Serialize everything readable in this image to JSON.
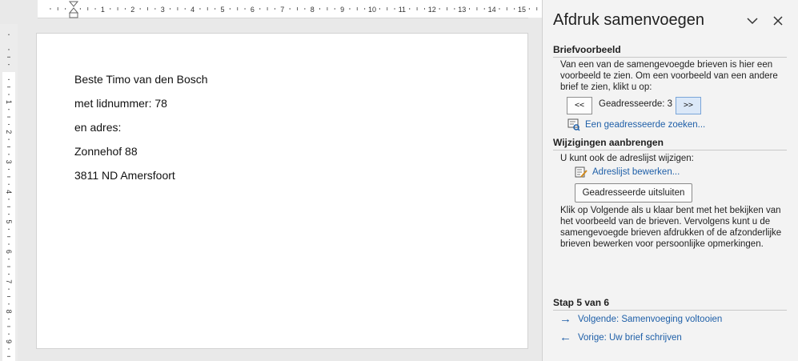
{
  "ruler": {
    "numbers": [
      "1",
      "2",
      "3",
      "4",
      "5",
      "6",
      "7",
      "8",
      "9",
      "10",
      "11",
      "12",
      "13",
      "14",
      "15"
    ],
    "vnumbers": [
      "1",
      "2",
      "3",
      "4",
      "5",
      "6",
      "7",
      "8",
      "9"
    ]
  },
  "document": {
    "lines": [
      "Beste Timo van den Bosch",
      "met lidnummer: 78",
      "en adres:",
      "Zonnehof 88",
      "3811 ND Amersfoort"
    ]
  },
  "pane": {
    "title": "Afdruk samenvoegen",
    "collapse_icon": "chevron-down-icon",
    "close_icon": "close-icon",
    "preview": {
      "heading": "Briefvoorbeeld",
      "description": "Van een van de samengevoegde brieven is hier een voorbeeld te zien. Om een voorbeeld van een andere brief te zien, klikt u op:",
      "prev_label": "<<",
      "recipient_label": "Geadresseerde: 3",
      "next_label": ">>",
      "find_link": "Een geadresseerde zoeken..."
    },
    "changes": {
      "heading": "Wijzigingen aanbrengen",
      "description": "U kunt ook de adreslijst wijzigen:",
      "edit_link": "Adreslijst bewerken...",
      "exclude_button": "Geadresseerde uitsluiten",
      "info": "Klik op Volgende als u klaar bent met het bekijken van het voorbeeld van de brieven. Vervolgens kunt u de samengevoegde brieven afdrukken of de afzonderlijke brieven bewerken voor persoonlijke opmerkingen."
    },
    "step": {
      "heading": "Stap 5 van 6",
      "next_link": "Volgende: Samenvoeging voltooien",
      "prev_link": "Vorige: Uw brief schrijven"
    }
  },
  "colors": {
    "link": "#1e5fa8",
    "pane_bg": "#f3f3f3",
    "next_btn_bg": "#dbe8f8"
  }
}
